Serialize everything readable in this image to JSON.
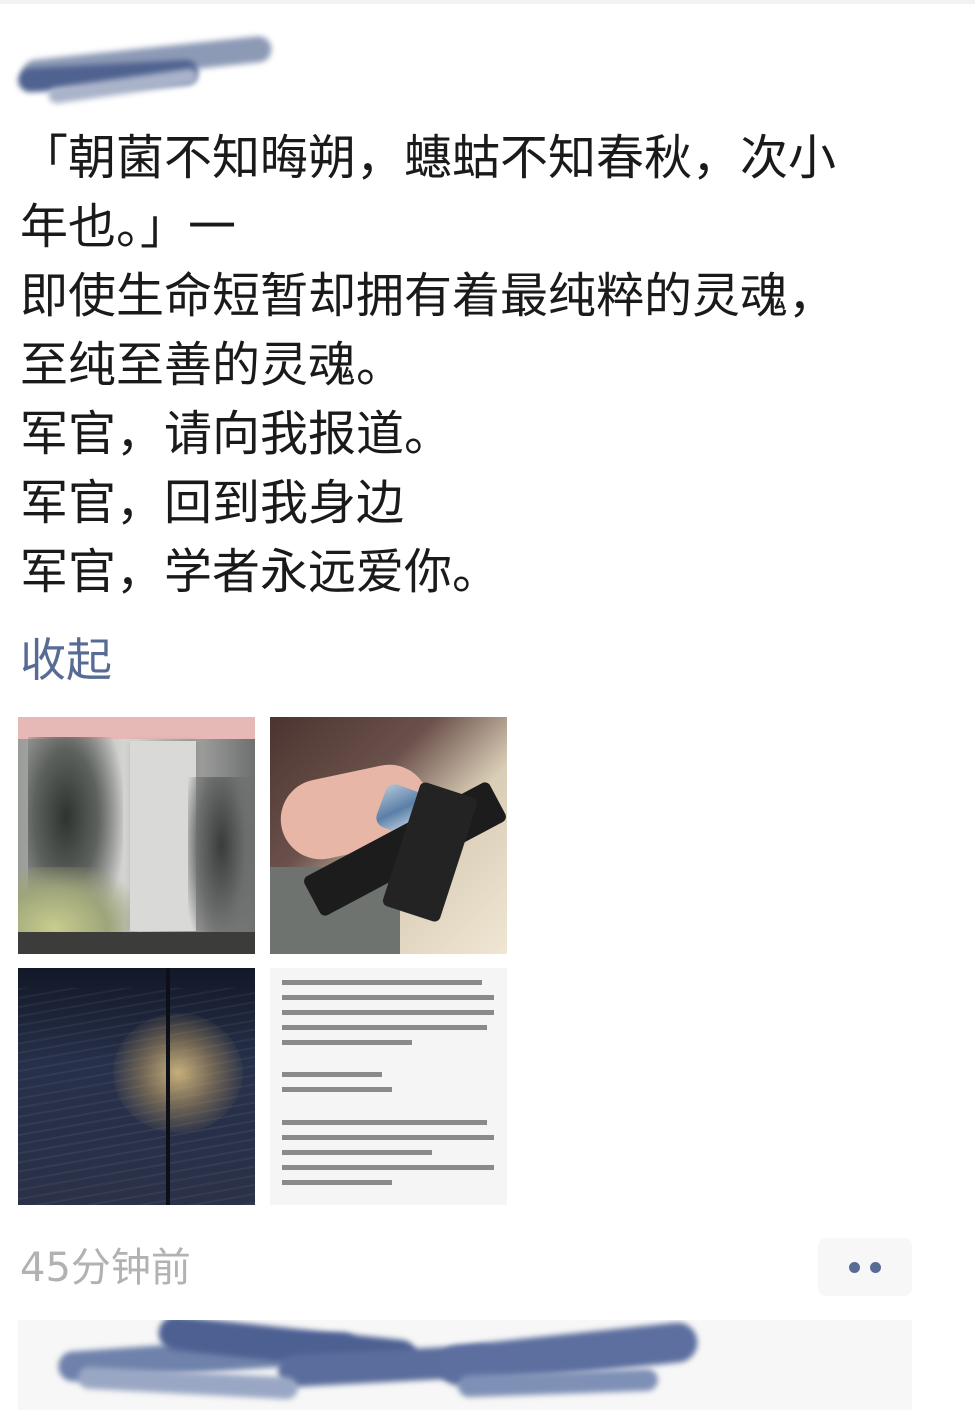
{
  "post": {
    "lines": [
      "「朝菌不知晦朔，蟪蛄不知春秋，次小",
      "年也。」一",
      "即使生命短暂却拥有着最纯粹的灵魂，",
      "至纯至善的灵魂。",
      "军官，请向我报道。",
      "军官，回到我身边",
      "军官，学者永远爱你。"
    ],
    "collapse_label": "收起",
    "timestamp": "45分钟前"
  },
  "icons": {
    "more": "more-dots-icon"
  },
  "colors": {
    "text": "#1a1a1a",
    "link": "#576b95",
    "timestamp": "#b2b2b2",
    "panel": "#f7f7f7",
    "background": "#ffffff"
  }
}
